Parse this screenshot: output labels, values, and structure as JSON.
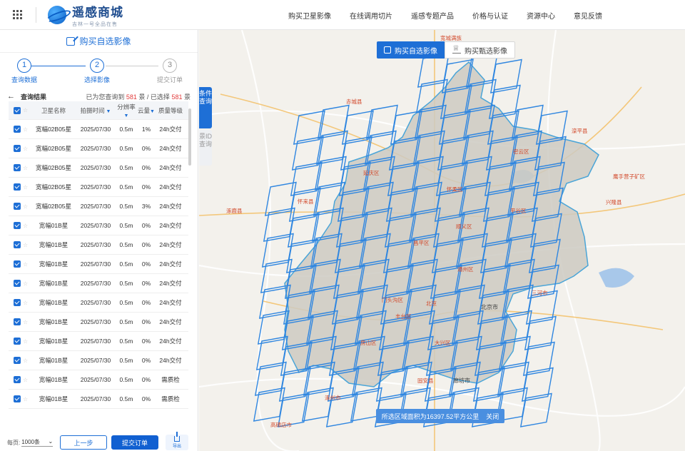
{
  "header": {
    "logo_title": "遥感商城",
    "logo_subtitle": "吉林一号全品在售",
    "nav": [
      "购买卫星影像",
      "在线调用切片",
      "遥感专题产品",
      "价格与认证",
      "资源中心",
      "意见反馈"
    ]
  },
  "panel": {
    "title": "购买自选影像",
    "steps": [
      {
        "num": "1",
        "label": "查询数据"
      },
      {
        "num": "2",
        "label": "选择影像"
      },
      {
        "num": "3",
        "label": "提交订单"
      }
    ],
    "results_title": "查询结果",
    "summary_prefix": "已为您查询到",
    "summary_found": "581",
    "summary_mid": "景 / 已选择",
    "summary_selected": "581",
    "summary_suffix": "景",
    "columns": [
      "卫星名称",
      "拍摄时间",
      "分辨率",
      "云量",
      "质量等级"
    ],
    "rows": [
      {
        "name": "宽幅02B05星",
        "date": "2025/07/30",
        "res": "0.5m",
        "cloud": "1%",
        "quality": "24h交付"
      },
      {
        "name": "宽幅02B05星",
        "date": "2025/07/30",
        "res": "0.5m",
        "cloud": "0%",
        "quality": "24h交付"
      },
      {
        "name": "宽幅02B05星",
        "date": "2025/07/30",
        "res": "0.5m",
        "cloud": "0%",
        "quality": "24h交付"
      },
      {
        "name": "宽幅02B05星",
        "date": "2025/07/30",
        "res": "0.5m",
        "cloud": "0%",
        "quality": "24h交付"
      },
      {
        "name": "宽幅02B05星",
        "date": "2025/07/30",
        "res": "0.5m",
        "cloud": "3%",
        "quality": "24h交付"
      },
      {
        "name": "宽幅01B星",
        "date": "2025/07/30",
        "res": "0.5m",
        "cloud": "0%",
        "quality": "24h交付"
      },
      {
        "name": "宽幅01B星",
        "date": "2025/07/30",
        "res": "0.5m",
        "cloud": "0%",
        "quality": "24h交付"
      },
      {
        "name": "宽幅01B星",
        "date": "2025/07/30",
        "res": "0.5m",
        "cloud": "0%",
        "quality": "24h交付"
      },
      {
        "name": "宽幅01B星",
        "date": "2025/07/30",
        "res": "0.5m",
        "cloud": "0%",
        "quality": "24h交付"
      },
      {
        "name": "宽幅01B星",
        "date": "2025/07/30",
        "res": "0.5m",
        "cloud": "0%",
        "quality": "24h交付"
      },
      {
        "name": "宽幅01B星",
        "date": "2025/07/30",
        "res": "0.5m",
        "cloud": "0%",
        "quality": "24h交付"
      },
      {
        "name": "宽幅01B星",
        "date": "2025/07/30",
        "res": "0.5m",
        "cloud": "0%",
        "quality": "24h交付"
      },
      {
        "name": "宽幅01B星",
        "date": "2025/07/30",
        "res": "0.5m",
        "cloud": "0%",
        "quality": "24h交付"
      },
      {
        "name": "宽幅01B星",
        "date": "2025/07/30",
        "res": "0.5m",
        "cloud": "0%",
        "quality": "需质检"
      },
      {
        "name": "宽幅01B星",
        "date": "2025/07/30",
        "res": "0.5m",
        "cloud": "0%",
        "quality": "需质检"
      }
    ],
    "footer": {
      "page_size_label": "每页:",
      "page_size_value": "1000条",
      "prev_label": "上一步",
      "submit_label": "提交订单",
      "export_label": "导出"
    }
  },
  "map": {
    "side_tabs": [
      "条件查询",
      "景ID查询"
    ],
    "mode_tabs": [
      "购买自选影像",
      "购买甄选影像"
    ],
    "area_text": "所选区域面积为16397.52平方公里",
    "area_close": "关闭",
    "labels": [
      {
        "t": "北京市",
        "k": "city"
      },
      {
        "t": "廊坊市",
        "k": "city"
      },
      {
        "t": "赤城县",
        "k": "red"
      },
      {
        "t": "怀来县",
        "k": "red"
      },
      {
        "t": "涿鹿县",
        "k": "red"
      },
      {
        "t": "滦平县",
        "k": "red"
      },
      {
        "t": "兴隆县",
        "k": "red"
      },
      {
        "t": "三河市",
        "k": "red"
      },
      {
        "t": "昌平区",
        "k": "red"
      },
      {
        "t": "门头沟区",
        "k": "red"
      },
      {
        "t": "丰台区",
        "k": "red"
      },
      {
        "t": "大兴区",
        "k": "red"
      },
      {
        "t": "固安县",
        "k": "red"
      },
      {
        "t": "涿州市",
        "k": "red"
      },
      {
        "t": "高碑店市",
        "k": "red"
      },
      {
        "t": "延庆区",
        "k": "red"
      },
      {
        "t": "怀柔区",
        "k": "red"
      },
      {
        "t": "密云区",
        "k": "red"
      },
      {
        "t": "平谷区",
        "k": "red"
      },
      {
        "t": "顺义区",
        "k": "red"
      },
      {
        "t": "通州区",
        "k": "red"
      },
      {
        "t": "房山区",
        "k": "red"
      },
      {
        "t": "宽城满族",
        "k": "red"
      },
      {
        "t": "鹰手营子矿区",
        "k": "red"
      },
      {
        "t": "北京",
        "k": "red"
      }
    ]
  }
}
